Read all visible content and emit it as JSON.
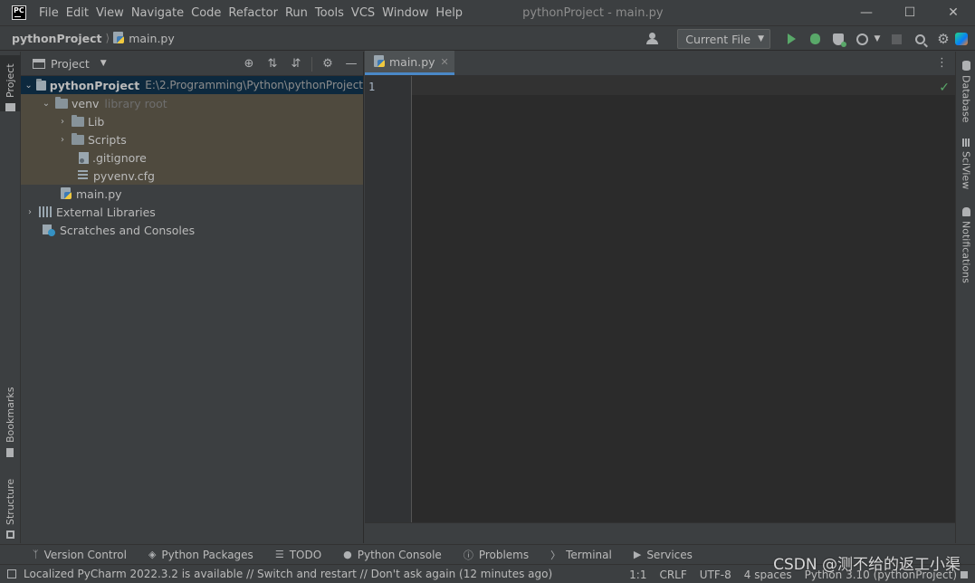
{
  "app": {
    "icon_label": "PC",
    "window_title": "pythonProject - main.py"
  },
  "menu": [
    "File",
    "Edit",
    "View",
    "Navigate",
    "Code",
    "Refactor",
    "Run",
    "Tools",
    "VCS",
    "Window",
    "Help"
  ],
  "breadcrumb": {
    "project": "pythonProject",
    "file": "main.py"
  },
  "toolbar": {
    "run_config": "Current File"
  },
  "project_panel": {
    "title": "Project",
    "tree": [
      {
        "label": "pythonProject",
        "extra": "E:\\2.Programming\\Python\\pythonProject"
      },
      {
        "label": "venv",
        "extra": "library root"
      },
      {
        "label": "Lib"
      },
      {
        "label": "Scripts"
      },
      {
        "label": ".gitignore"
      },
      {
        "label": "pyvenv.cfg"
      },
      {
        "label": "main.py"
      },
      {
        "label": "External Libraries"
      },
      {
        "label": "Scratches and Consoles"
      }
    ]
  },
  "editor": {
    "tab": "main.py",
    "line_number": "1"
  },
  "left_tabs": {
    "project": "Project",
    "bookmarks": "Bookmarks",
    "structure": "Structure"
  },
  "right_tabs": {
    "database": "Database",
    "sciview": "SciView",
    "notifications": "Notifications"
  },
  "bottom_tools": [
    "Version Control",
    "Python Packages",
    "TODO",
    "Python Console",
    "Problems",
    "Terminal",
    "Services"
  ],
  "status": {
    "message": "Localized PyCharm 2022.3.2 is available // Switch and restart // Don't ask again (12 minutes ago)",
    "position": "1:1",
    "line_sep": "CRLF",
    "encoding": "UTF-8",
    "indent": "4 spaces",
    "interpreter": "Python 3.10 (pythonProject)"
  },
  "watermark": "CSDN @测不给的返工小渠"
}
